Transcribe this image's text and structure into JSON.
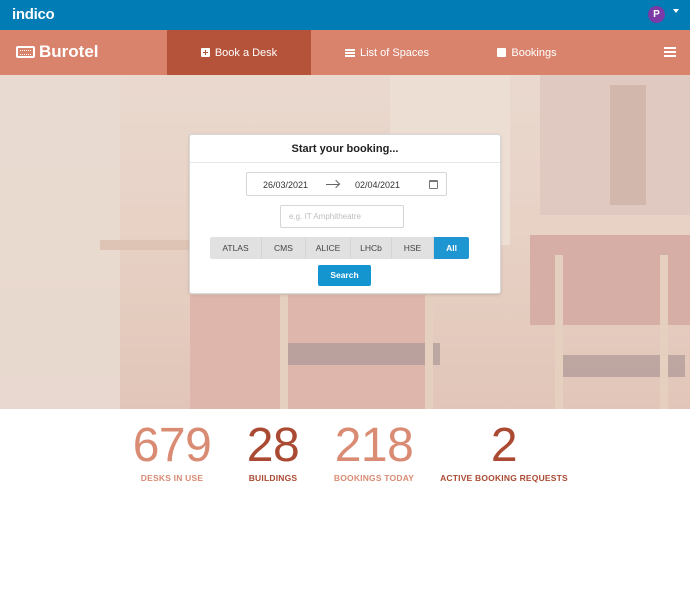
{
  "topbar": {
    "logo_text": "indico",
    "avatar_initial": "P",
    "avatar_color": "#7b3aa5",
    "bar_color": "#017cb5"
  },
  "navbar": {
    "brand": "Burotel",
    "brand_icon": "keyboard-icon",
    "items": [
      {
        "label": "Book a Desk",
        "icon": "plus-square-icon",
        "active": true
      },
      {
        "label": "List of Spaces",
        "icon": "list-icon",
        "active": false
      },
      {
        "label": "Bookings",
        "icon": "calendar-icon",
        "active": false
      }
    ],
    "menu_icon": "hamburger-icon",
    "bar_color": "#d9826c",
    "active_color": "#b5523a"
  },
  "booking": {
    "title": "Start your booking...",
    "start_date": "26/03/2021",
    "end_date": "02/04/2021",
    "search_placeholder": "e.g. IT Amphitheatre",
    "filters": [
      {
        "label": "ATLAS",
        "active": false
      },
      {
        "label": "CMS",
        "active": false
      },
      {
        "label": "ALICE",
        "active": false
      },
      {
        "label": "LHCb",
        "active": false
      },
      {
        "label": "HSE",
        "active": false
      },
      {
        "label": "All",
        "active": true
      }
    ],
    "search_button": "Search",
    "accent_color": "#1595cf"
  },
  "stats": [
    {
      "value": "679",
      "label": "DESKS IN USE",
      "color": "#d98b73"
    },
    {
      "value": "28",
      "label": "BUILDINGS",
      "color": "#ab4a33"
    },
    {
      "value": "218",
      "label": "BOOKINGS TODAY",
      "color": "#d98b73"
    },
    {
      "value": "2",
      "label": "ACTIVE BOOKING REQUESTS",
      "color": "#ab4a33"
    }
  ]
}
